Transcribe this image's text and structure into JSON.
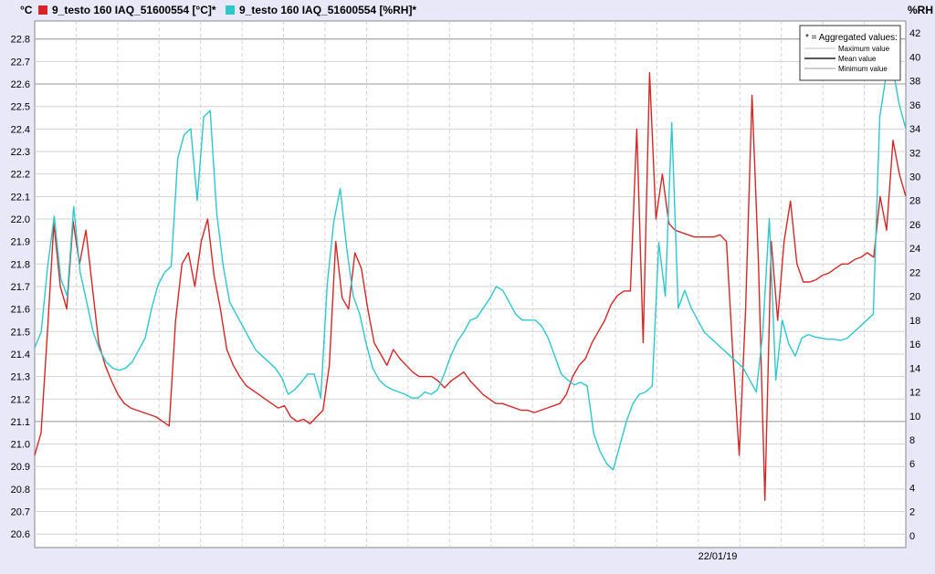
{
  "header": {
    "left_unit": "°C",
    "right_unit": "%RH"
  },
  "legend": [
    {
      "label": "9_testo 160 IAQ_51600554 [°C]*",
      "color": "#d62728"
    },
    {
      "label": "9_testo 160 IAQ_51600554 [%RH]*",
      "color": "#2ec8cc"
    }
  ],
  "aggregate_box": {
    "title": "* = Aggregated values:",
    "items": [
      "Maximum value",
      "Mean value",
      "Minimum value"
    ]
  },
  "chart_data": [
    {
      "type": "line",
      "x_tick_label": "22/01/19",
      "yleft_ticks": [
        "22.8",
        "22.7",
        "22.6",
        "22.5",
        "22.4",
        "22.3",
        "22.2",
        "22.1",
        "22.0",
        "21.9",
        "21.8",
        "21.7",
        "21.6",
        "21.5",
        "21.4",
        "21.3",
        "21.2",
        "21.1",
        "21.0",
        "20.9",
        "20.8",
        "20.7",
        "20.6"
      ],
      "yright_ticks": [
        "42",
        "40",
        "38",
        "36",
        "34",
        "32",
        "30",
        "28",
        "26",
        "24",
        "22",
        "20",
        "18",
        "16",
        "14",
        "12",
        "10",
        "8",
        "6",
        "4",
        "2",
        "0"
      ],
      "ylim_left": [
        20.54,
        22.88
      ],
      "ylim_right": [
        -1.0,
        43.0
      ],
      "grid": true,
      "legend_position": "top",
      "series": [
        {
          "name": "9_testo 160 IAQ_51600554 [°C]*",
          "axis": "left",
          "color": "#d62728",
          "values": [
            20.95,
            21.05,
            21.5,
            21.98,
            21.7,
            21.6,
            21.99,
            21.8,
            21.95,
            21.7,
            21.45,
            21.35,
            21.28,
            21.22,
            21.18,
            21.16,
            21.15,
            21.14,
            21.13,
            21.12,
            21.1,
            21.08,
            21.55,
            21.8,
            21.85,
            21.7,
            21.9,
            22.0,
            21.75,
            21.6,
            21.42,
            21.35,
            21.3,
            21.26,
            21.24,
            21.22,
            21.2,
            21.18,
            21.16,
            21.17,
            21.12,
            21.1,
            21.11,
            21.09,
            21.12,
            21.15,
            21.35,
            21.9,
            21.65,
            21.6,
            21.85,
            21.78,
            21.6,
            21.45,
            21.4,
            21.35,
            21.42,
            21.38,
            21.35,
            21.32,
            21.3,
            21.3,
            21.3,
            21.28,
            21.25,
            21.28,
            21.3,
            21.32,
            21.28,
            21.25,
            21.22,
            21.2,
            21.18,
            21.18,
            21.17,
            21.16,
            21.15,
            21.15,
            21.14,
            21.15,
            21.16,
            21.17,
            21.18,
            21.22,
            21.3,
            21.35,
            21.38,
            21.45,
            21.5,
            21.55,
            21.62,
            21.66,
            21.68,
            21.68,
            22.4,
            21.45,
            22.65,
            22.0,
            22.2,
            21.98,
            21.95,
            21.94,
            21.93,
            21.92,
            21.92,
            21.92,
            21.92,
            21.93,
            21.9,
            21.4,
            20.95,
            21.6,
            22.55,
            21.8,
            20.75,
            21.9,
            21.55,
            21.9,
            22.08,
            21.8,
            21.72,
            21.72,
            21.73,
            21.75,
            21.76,
            21.78,
            21.8,
            21.8,
            21.82,
            21.83,
            21.85,
            21.83,
            22.1,
            21.95,
            22.35,
            22.2,
            22.1
          ]
        },
        {
          "name": "9_testo 160 IAQ_51600554 [%RH]*",
          "axis": "right",
          "color": "#2ec8cc",
          "values": [
            15.7,
            17.0,
            22.5,
            26.7,
            21.5,
            20.0,
            27.5,
            22.0,
            19.5,
            17.0,
            15.5,
            14.5,
            14.0,
            13.8,
            14.0,
            14.5,
            15.5,
            16.5,
            19.0,
            21.0,
            22.0,
            22.5,
            31.5,
            33.5,
            34.0,
            28.0,
            35.0,
            35.5,
            27.0,
            22.5,
            19.5,
            18.5,
            17.5,
            16.5,
            15.5,
            15.0,
            14.5,
            14.0,
            13.2,
            11.8,
            12.2,
            12.8,
            13.5,
            13.5,
            11.5,
            21.0,
            26.2,
            29.0,
            24.0,
            20.0,
            18.5,
            16.0,
            14.0,
            13.0,
            12.5,
            12.2,
            12.0,
            11.8,
            11.5,
            11.5,
            12.0,
            11.8,
            12.2,
            13.5,
            15.0,
            16.2,
            17.0,
            18.0,
            18.2,
            19.0,
            19.8,
            20.8,
            20.5,
            19.5,
            18.5,
            18.0,
            18.0,
            18.0,
            17.5,
            16.5,
            15.0,
            13.5,
            13.0,
            12.6,
            12.8,
            12.5,
            8.5,
            7.0,
            6.0,
            5.5,
            7.5,
            9.5,
            11.0,
            11.8,
            12.0,
            12.5,
            24.5,
            20.0,
            34.5,
            19.0,
            20.5,
            19.0,
            18.0,
            17.0,
            16.5,
            16.0,
            15.5,
            15.0,
            14.5,
            14.0,
            13.0,
            12.0,
            17.0,
            26.5,
            13.0,
            18.0,
            16.0,
            15.0,
            16.5,
            16.8,
            16.6,
            16.5,
            16.4,
            16.4,
            16.3,
            16.5,
            17.0,
            17.5,
            18.0,
            18.5,
            35.0,
            38.5,
            39.0,
            36.0,
            34.0
          ]
        }
      ]
    }
  ]
}
